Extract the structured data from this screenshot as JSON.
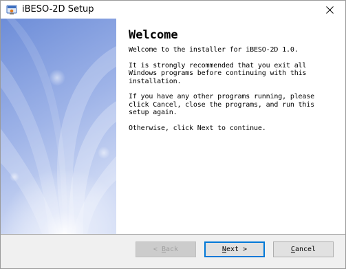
{
  "window": {
    "title": "iBESO-2D Setup"
  },
  "welcome": {
    "heading": "Welcome",
    "paragraphs": [
      "Welcome to the installer for iBESO-2D 1.0.",
      "It is strongly recommended that you exit all\nWindows programs before continuing with this\ninstallation.",
      "If you have any other programs running, please\nclick Cancel, close the programs, and run this\nsetup again.",
      "Otherwise, click Next to continue."
    ]
  },
  "buttons": {
    "back": {
      "mnemonic": "B",
      "rest": "ack",
      "prefix": "< ",
      "suffix": "",
      "enabled": false
    },
    "next": {
      "mnemonic": "N",
      "rest": "ext",
      "prefix": "",
      "suffix": " >",
      "enabled": true
    },
    "cancel": {
      "mnemonic": "C",
      "rest": "ancel",
      "prefix": "",
      "suffix": "",
      "enabled": true
    }
  },
  "icons": {
    "app": "installer-icon",
    "close": "close-icon"
  },
  "colors": {
    "banner_top": "#6f8fd9",
    "banner_bottom": "#c6d4f3",
    "default_button_border": "#0078d7",
    "footer_bg": "#f0f0f0"
  }
}
